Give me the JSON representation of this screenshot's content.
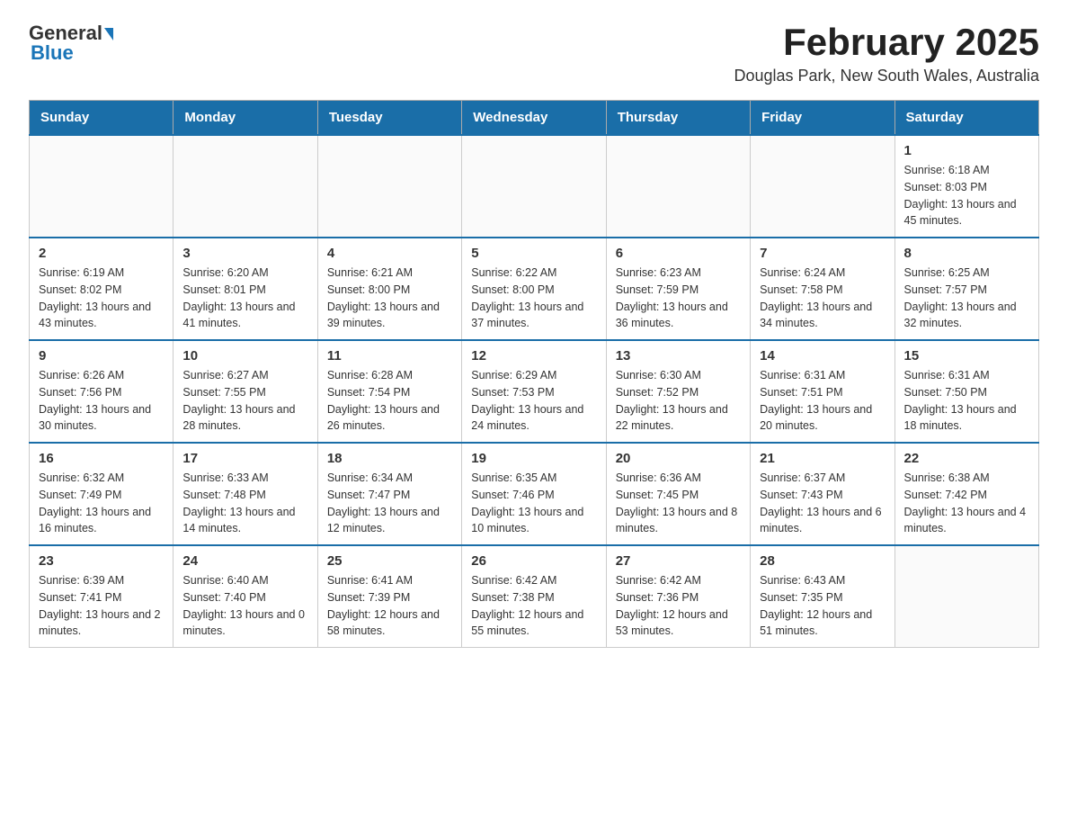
{
  "header": {
    "logo_general": "General",
    "logo_blue": "Blue",
    "month_title": "February 2025",
    "location": "Douglas Park, New South Wales, Australia"
  },
  "days_of_week": [
    "Sunday",
    "Monday",
    "Tuesday",
    "Wednesday",
    "Thursday",
    "Friday",
    "Saturday"
  ],
  "weeks": [
    {
      "days": [
        {
          "num": "",
          "info": ""
        },
        {
          "num": "",
          "info": ""
        },
        {
          "num": "",
          "info": ""
        },
        {
          "num": "",
          "info": ""
        },
        {
          "num": "",
          "info": ""
        },
        {
          "num": "",
          "info": ""
        },
        {
          "num": "1",
          "info": "Sunrise: 6:18 AM\nSunset: 8:03 PM\nDaylight: 13 hours and 45 minutes."
        }
      ]
    },
    {
      "days": [
        {
          "num": "2",
          "info": "Sunrise: 6:19 AM\nSunset: 8:02 PM\nDaylight: 13 hours and 43 minutes."
        },
        {
          "num": "3",
          "info": "Sunrise: 6:20 AM\nSunset: 8:01 PM\nDaylight: 13 hours and 41 minutes."
        },
        {
          "num": "4",
          "info": "Sunrise: 6:21 AM\nSunset: 8:00 PM\nDaylight: 13 hours and 39 minutes."
        },
        {
          "num": "5",
          "info": "Sunrise: 6:22 AM\nSunset: 8:00 PM\nDaylight: 13 hours and 37 minutes."
        },
        {
          "num": "6",
          "info": "Sunrise: 6:23 AM\nSunset: 7:59 PM\nDaylight: 13 hours and 36 minutes."
        },
        {
          "num": "7",
          "info": "Sunrise: 6:24 AM\nSunset: 7:58 PM\nDaylight: 13 hours and 34 minutes."
        },
        {
          "num": "8",
          "info": "Sunrise: 6:25 AM\nSunset: 7:57 PM\nDaylight: 13 hours and 32 minutes."
        }
      ]
    },
    {
      "days": [
        {
          "num": "9",
          "info": "Sunrise: 6:26 AM\nSunset: 7:56 PM\nDaylight: 13 hours and 30 minutes."
        },
        {
          "num": "10",
          "info": "Sunrise: 6:27 AM\nSunset: 7:55 PM\nDaylight: 13 hours and 28 minutes."
        },
        {
          "num": "11",
          "info": "Sunrise: 6:28 AM\nSunset: 7:54 PM\nDaylight: 13 hours and 26 minutes."
        },
        {
          "num": "12",
          "info": "Sunrise: 6:29 AM\nSunset: 7:53 PM\nDaylight: 13 hours and 24 minutes."
        },
        {
          "num": "13",
          "info": "Sunrise: 6:30 AM\nSunset: 7:52 PM\nDaylight: 13 hours and 22 minutes."
        },
        {
          "num": "14",
          "info": "Sunrise: 6:31 AM\nSunset: 7:51 PM\nDaylight: 13 hours and 20 minutes."
        },
        {
          "num": "15",
          "info": "Sunrise: 6:31 AM\nSunset: 7:50 PM\nDaylight: 13 hours and 18 minutes."
        }
      ]
    },
    {
      "days": [
        {
          "num": "16",
          "info": "Sunrise: 6:32 AM\nSunset: 7:49 PM\nDaylight: 13 hours and 16 minutes."
        },
        {
          "num": "17",
          "info": "Sunrise: 6:33 AM\nSunset: 7:48 PM\nDaylight: 13 hours and 14 minutes."
        },
        {
          "num": "18",
          "info": "Sunrise: 6:34 AM\nSunset: 7:47 PM\nDaylight: 13 hours and 12 minutes."
        },
        {
          "num": "19",
          "info": "Sunrise: 6:35 AM\nSunset: 7:46 PM\nDaylight: 13 hours and 10 minutes."
        },
        {
          "num": "20",
          "info": "Sunrise: 6:36 AM\nSunset: 7:45 PM\nDaylight: 13 hours and 8 minutes."
        },
        {
          "num": "21",
          "info": "Sunrise: 6:37 AM\nSunset: 7:43 PM\nDaylight: 13 hours and 6 minutes."
        },
        {
          "num": "22",
          "info": "Sunrise: 6:38 AM\nSunset: 7:42 PM\nDaylight: 13 hours and 4 minutes."
        }
      ]
    },
    {
      "days": [
        {
          "num": "23",
          "info": "Sunrise: 6:39 AM\nSunset: 7:41 PM\nDaylight: 13 hours and 2 minutes."
        },
        {
          "num": "24",
          "info": "Sunrise: 6:40 AM\nSunset: 7:40 PM\nDaylight: 13 hours and 0 minutes."
        },
        {
          "num": "25",
          "info": "Sunrise: 6:41 AM\nSunset: 7:39 PM\nDaylight: 12 hours and 58 minutes."
        },
        {
          "num": "26",
          "info": "Sunrise: 6:42 AM\nSunset: 7:38 PM\nDaylight: 12 hours and 55 minutes."
        },
        {
          "num": "27",
          "info": "Sunrise: 6:42 AM\nSunset: 7:36 PM\nDaylight: 12 hours and 53 minutes."
        },
        {
          "num": "28",
          "info": "Sunrise: 6:43 AM\nSunset: 7:35 PM\nDaylight: 12 hours and 51 minutes."
        },
        {
          "num": "",
          "info": ""
        }
      ]
    }
  ]
}
